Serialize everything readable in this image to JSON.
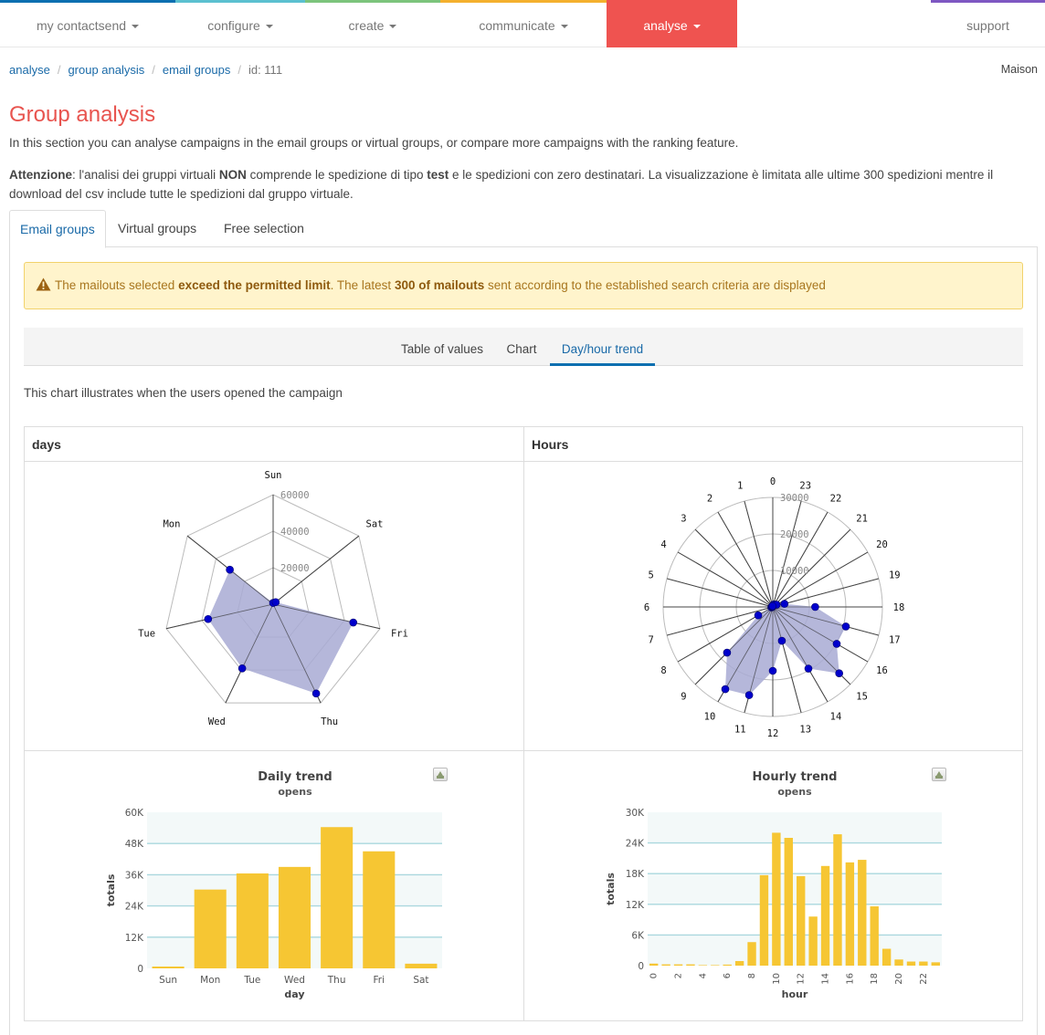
{
  "nav": {
    "items": [
      {
        "label": "my contactsend",
        "color": "#0c6fb0",
        "caret": true
      },
      {
        "label": "configure",
        "color": "#5bc0d0",
        "caret": true
      },
      {
        "label": "create",
        "color": "#7cc47c",
        "caret": true
      },
      {
        "label": "communicate",
        "color": "#f4b02e",
        "caret": true
      },
      {
        "label": "analyse",
        "color": "#ef5350",
        "caret": true,
        "active": true
      },
      {
        "label": "support",
        "color": "#7e57c2",
        "caret": false
      }
    ]
  },
  "breadcrumb": [
    "analyse",
    "group analysis",
    "email groups",
    "id: 111"
  ],
  "user": "Maison",
  "page": {
    "title": "Group analysis",
    "intro": "In this section you can analyse campaigns in the email groups or virtual groups, or compare more campaigns with the ranking feature.",
    "warning": {
      "label": "Attenzione",
      "t1": ": l'analisi dei gruppi virtuali ",
      "b1": "NON",
      "t2": " comprende le spedizione di tipo ",
      "b2": "test",
      "t3": " e le spedizioni con zero destinatari. La visualizzazione è limitata alle ultime 300 spedizioni mentre il download del csv include tutte le spedizioni dal gruppo virtuale."
    }
  },
  "tabs": [
    "Email groups",
    "Virtual groups",
    "Free selection"
  ],
  "alert": {
    "t1": "The mailouts selected ",
    "b1": "exceed the permitted limit",
    "t2": ". The latest ",
    "b2": "300 of mailouts",
    "t3": " sent according to the established search criteria are displayed"
  },
  "subtabs": [
    "Table of values",
    "Chart",
    "Day/hour trend"
  ],
  "description": "This chart illustrates when the users opened the campaign",
  "panels": {
    "days": "days",
    "hours": "Hours"
  },
  "chart_data": [
    {
      "type": "radar",
      "title": "days",
      "categories": [
        "Sun",
        "Sat",
        "Fri",
        "Thu",
        "Wed",
        "Tue",
        "Mon"
      ],
      "values": [
        700,
        1800,
        45000,
        54300,
        39000,
        36500,
        30300
      ],
      "scale_max": 60000,
      "ticks": [
        20000,
        40000,
        60000
      ],
      "fill_color": "#a8aad4",
      "point_color": "#0000cc"
    },
    {
      "type": "radar",
      "title": "Hours",
      "categories": [
        "0",
        "23",
        "22",
        "21",
        "20",
        "19",
        "18",
        "17",
        "16",
        "15",
        "14",
        "13",
        "12",
        "11",
        "10",
        "9",
        "8",
        "7",
        "6",
        "5",
        "4",
        "3",
        "2",
        "1"
      ],
      "values": [
        400,
        650,
        800,
        800,
        1200,
        3300,
        11600,
        20700,
        20200,
        25700,
        19500,
        9600,
        17500,
        25000,
        26000,
        17700,
        4600,
        400,
        200,
        100,
        100,
        250,
        250,
        250
      ],
      "scale_max": 30000,
      "ticks": [
        10000,
        20000,
        30000
      ],
      "fill_color": "#a8aad4",
      "point_color": "#0000cc"
    },
    {
      "type": "bar",
      "title": "Daily trend",
      "subtitle": "opens",
      "xlabel": "day",
      "ylabel": "totals",
      "categories": [
        "Sun",
        "Mon",
        "Tue",
        "Wed",
        "Thu",
        "Fri",
        "Sat"
      ],
      "values": [
        700,
        30300,
        36500,
        39000,
        54300,
        45000,
        1800
      ],
      "ylim": [
        0,
        60000
      ],
      "yticks": [
        0,
        12000,
        24000,
        36000,
        48000,
        60000
      ],
      "ytick_labels": [
        "0",
        "12K",
        "24K",
        "36K",
        "48K",
        "60K"
      ],
      "bar_color": "#f6c633",
      "grid": true
    },
    {
      "type": "bar",
      "title": "Hourly trend",
      "subtitle": "opens",
      "xlabel": "hour",
      "ylabel": "totals",
      "categories": [
        "0",
        "1",
        "2",
        "3",
        "4",
        "5",
        "6",
        "7",
        "8",
        "9",
        "10",
        "11",
        "12",
        "13",
        "14",
        "15",
        "16",
        "17",
        "18",
        "19",
        "20",
        "21",
        "22",
        "23"
      ],
      "xtick_labels": [
        "0",
        "2",
        "4",
        "6",
        "8",
        "10",
        "12",
        "14",
        "16",
        "18",
        "20",
        "22"
      ],
      "values": [
        400,
        250,
        250,
        250,
        100,
        100,
        200,
        900,
        4600,
        17700,
        26000,
        25000,
        17500,
        9600,
        19500,
        25700,
        20200,
        20700,
        11600,
        3300,
        1200,
        800,
        800,
        650
      ],
      "ylim": [
        0,
        30000
      ],
      "yticks": [
        0,
        6000,
        12000,
        18000,
        24000,
        30000
      ],
      "ytick_labels": [
        "0",
        "6K",
        "12K",
        "18K",
        "24K",
        "30K"
      ],
      "bar_color": "#f6c633",
      "grid": true
    }
  ]
}
